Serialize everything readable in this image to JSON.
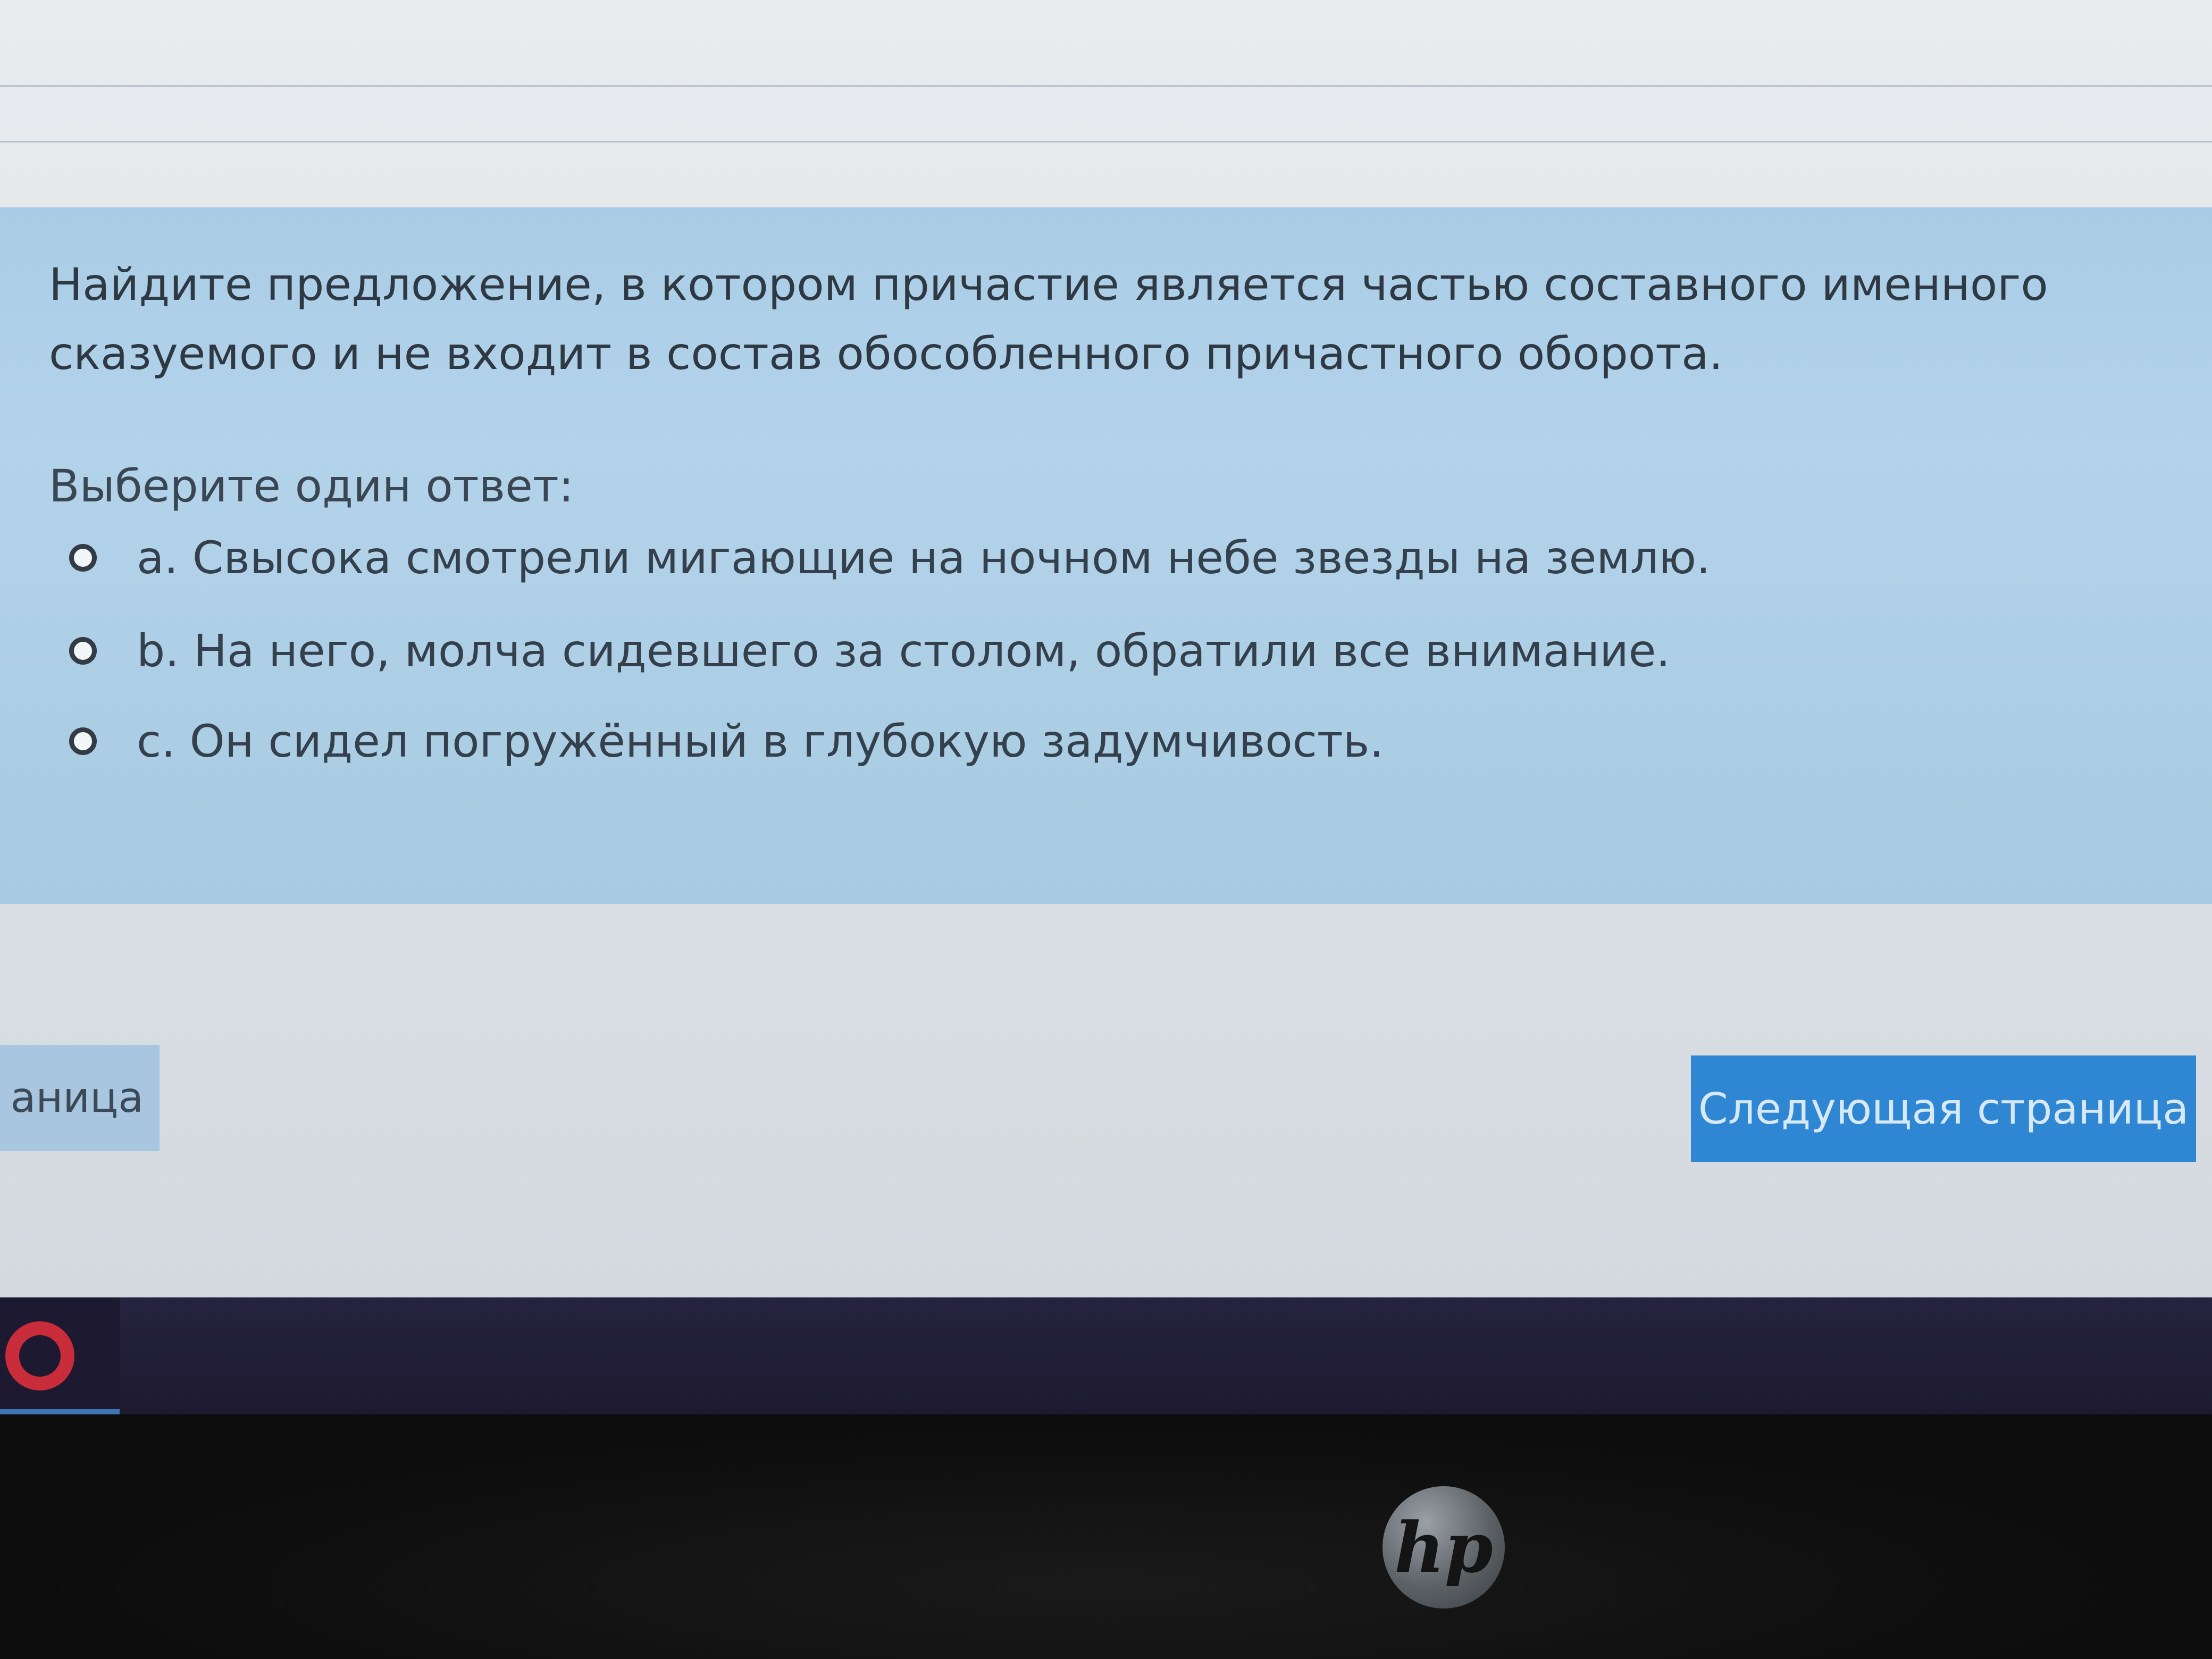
{
  "question": {
    "text": "Найдите предложение, в котором причастие является частью составного именного сказуемого и не входит в состав обособленного причастного оборота.",
    "prompt": "Выберите один ответ:",
    "answers": [
      {
        "label": "a. Свысока смотрели мигающие на ночном небе звезды на землю."
      },
      {
        "label": "b. На него, молча сидевшего за столом, обратили все внимание."
      },
      {
        "label": "c. Он сидел погружённый в глубокую задумчивость."
      }
    ]
  },
  "navigation": {
    "prev_label": "аница",
    "next_label": "Следующая страница"
  },
  "taskbar": {
    "app_icon": "opera-icon"
  },
  "device": {
    "logo_text": "hp"
  },
  "colors": {
    "panel": "#b3d3ea",
    "next_button": "#2f86d2",
    "taskbar": "#26233f"
  }
}
